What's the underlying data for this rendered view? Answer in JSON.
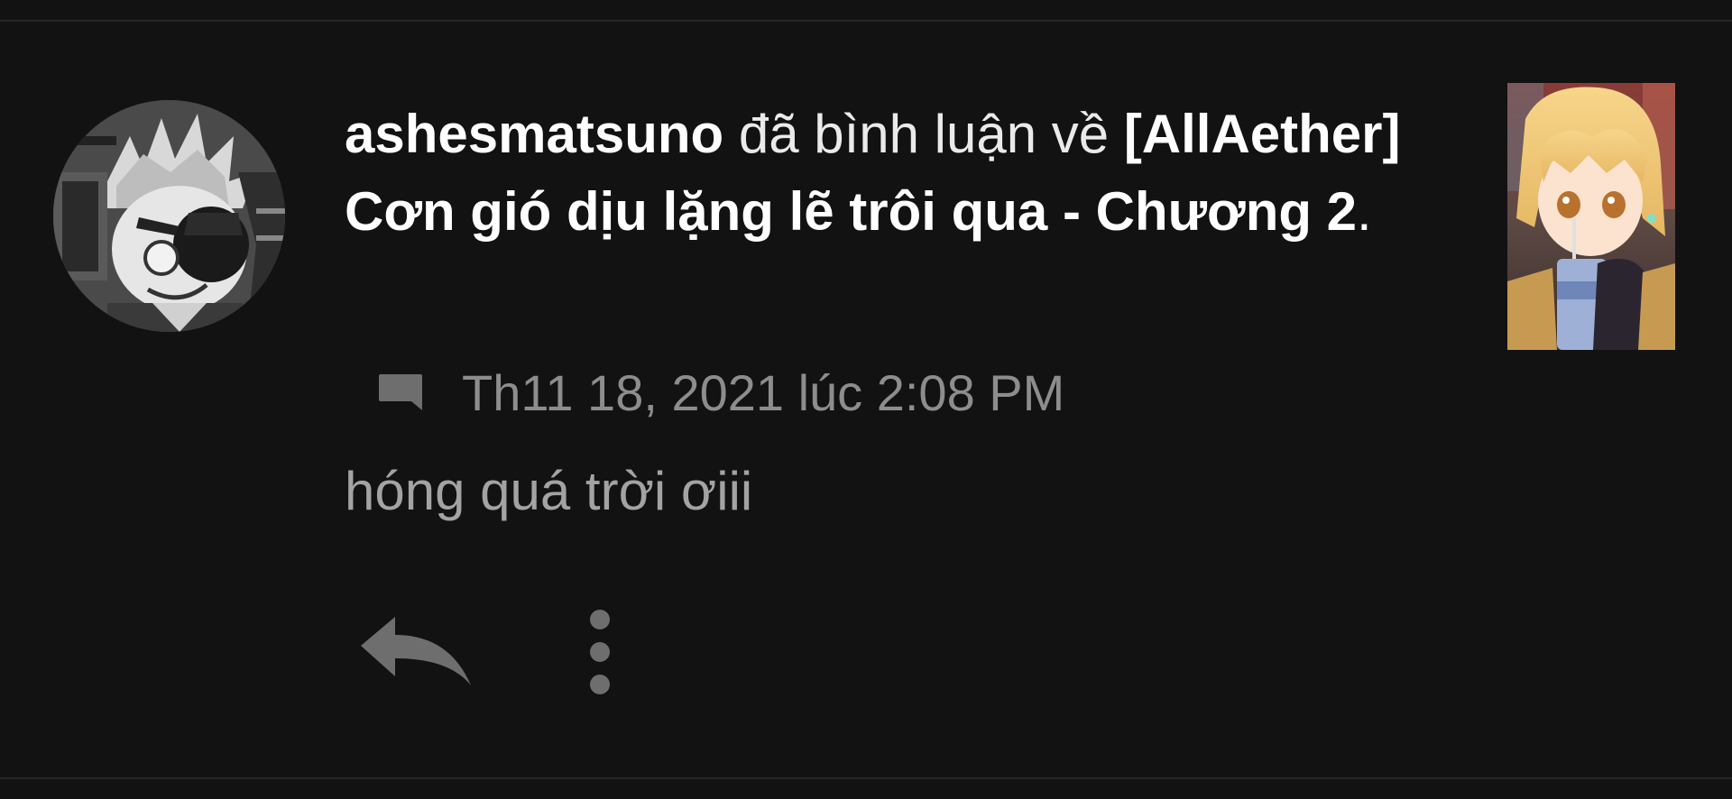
{
  "notification": {
    "username": "ashesmatsuno",
    "action_text": " đã bình luận về ",
    "story_title": "[AllAether] Cơn gió dịu lặng lẽ trôi qua - Chương 2",
    "trailing_period": ".",
    "timestamp": "Th11 18, 2021 lúc 2:08 PM",
    "comment_text": "hóng quá trời ơiii"
  },
  "icons": {
    "meta": "comment-bubble-icon",
    "reply": "reply-arrow-icon",
    "more": "more-vertical-icon"
  },
  "colors": {
    "background": "#121212",
    "divider": "#262626",
    "primary_text": "#ffffff",
    "timestamp_text": "#8d8d8d",
    "comment_text": "#a3a3a3",
    "icon": "#6e6e6e"
  }
}
